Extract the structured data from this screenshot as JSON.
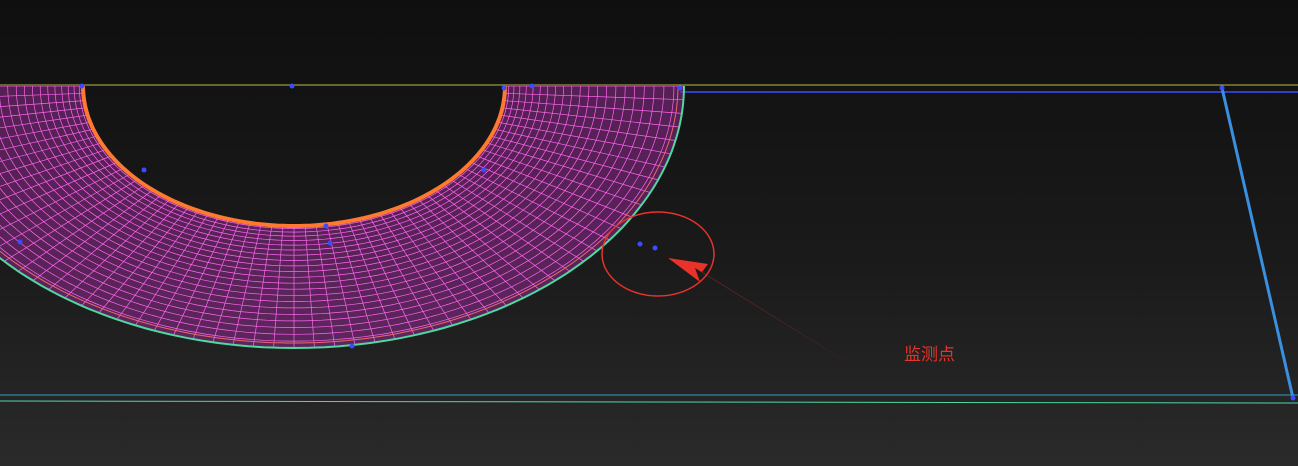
{
  "viewport": {
    "label": "mesh-viewport",
    "background_top": "#0f0f0f",
    "background_bottom": "#2a2a2a"
  },
  "mesh": {
    "fill_color": "#c23ec0",
    "line_color": "#ff66ee",
    "inner_edge_color": "#ff7a30",
    "outer_edge_color": "#4fd8a0",
    "boundary_color": "#c8c84a",
    "domain_edge_color": "#3a4cff",
    "slanted_edge_color": "#3a8fe0",
    "vertex_color": "#3a4cff"
  },
  "annotation": {
    "label": "监测点",
    "color": "#e8322a"
  }
}
